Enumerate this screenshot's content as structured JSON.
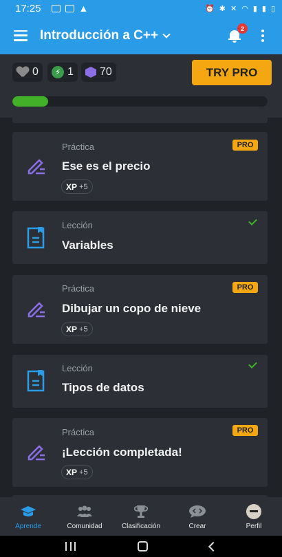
{
  "status_bar": {
    "time": "17:25",
    "battery_text": ""
  },
  "app_bar": {
    "course_title": "Introducción a C++",
    "notification_count": "2"
  },
  "stats": {
    "hearts": "0",
    "streak": "1",
    "gems": "70",
    "try_pro_label": "TRY PRO",
    "progress_fraction": 0.14,
    "progress_color": "#43b02a"
  },
  "cards": [
    {
      "type": "Práctica",
      "title": "Ese es el precio",
      "pro": "PRO",
      "xp_label": "XP",
      "xp_value": "+5",
      "icon": "pencil-icon",
      "completed": false
    },
    {
      "type": "Lección",
      "title": "Variables",
      "icon": "document-icon",
      "completed": true
    },
    {
      "type": "Práctica",
      "title": "Dibujar un copo de nieve",
      "pro": "PRO",
      "xp_label": "XP",
      "xp_value": "+5",
      "icon": "pencil-icon",
      "completed": false
    },
    {
      "type": "Lección",
      "title": "Tipos de datos",
      "icon": "document-icon",
      "completed": true
    },
    {
      "type": "Práctica",
      "title": "¡Lección completada!",
      "pro": "PRO",
      "xp_label": "XP",
      "xp_value": "+5",
      "icon": "pencil-icon",
      "completed": false
    }
  ],
  "bottom_nav": [
    {
      "label": "Aprende",
      "icon": "graduation-cap-icon",
      "active": true
    },
    {
      "label": "Comunidad",
      "icon": "people-icon",
      "active": false
    },
    {
      "label": "Clasificación",
      "icon": "trophy-icon",
      "active": false
    },
    {
      "label": "Crear",
      "icon": "code-bubble-icon",
      "active": false
    },
    {
      "label": "Perfil",
      "icon": "avatar",
      "active": false
    }
  ],
  "colors": {
    "accent_blue": "#2a9be6",
    "pro_orange": "#f5a712",
    "practice_purple": "#8c6ee6",
    "lesson_blue": "#2a9be6",
    "success_green": "#43b02a"
  }
}
